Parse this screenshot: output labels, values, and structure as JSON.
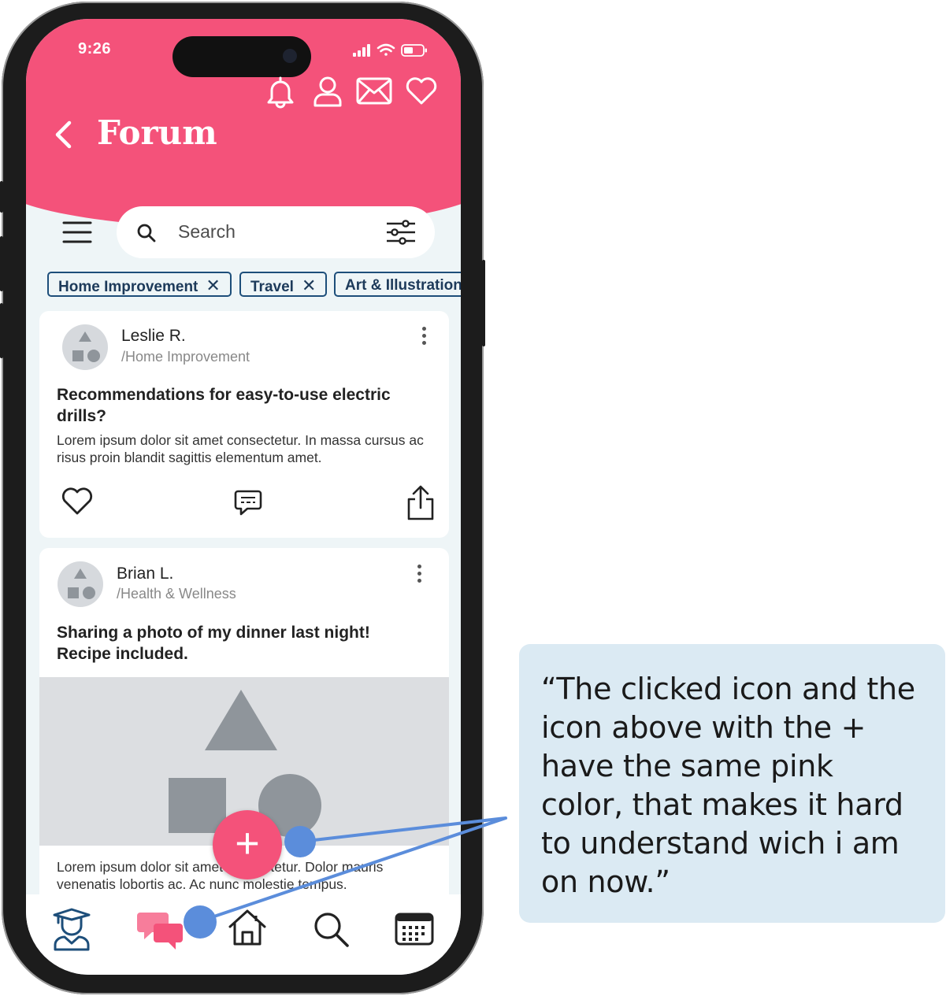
{
  "status_bar": {
    "time": "9:26"
  },
  "header": {
    "title": "Forum"
  },
  "search": {
    "placeholder": "Search"
  },
  "chips": [
    {
      "label": "Home Improvement"
    },
    {
      "label": "Travel"
    },
    {
      "label": "Art & Illustration"
    }
  ],
  "posts": [
    {
      "author": "Leslie R.",
      "category": "/Home Improvement",
      "title": "Recommendations for easy-to-use electric drills?",
      "body": "Lorem ipsum dolor sit amet consectetur. In massa cursus ac risus proin blandit sagittis elementum amet."
    },
    {
      "author": "Brian L.",
      "category": "/Health & Wellness",
      "title": "Sharing a photo of my dinner last night! Recipe included.",
      "body": "Lorem ipsum dolor sit amet consectetur. Dolor mauris venenatis lobortis ac. Ac nunc molestie tempus."
    }
  ],
  "fab": {
    "label": "+"
  },
  "tab_bar": {
    "items": [
      {
        "icon": "graduate-icon"
      },
      {
        "icon": "chat-bubbles-icon",
        "active": true
      },
      {
        "icon": "home-icon"
      },
      {
        "icon": "search-icon"
      },
      {
        "icon": "calendar-icon"
      }
    ]
  },
  "colors": {
    "brand_pink": "#f4527a",
    "chip_border": "#1d4e7a",
    "annotation_blue": "#5b8ddb",
    "callout_bg": "#dbeaf3"
  },
  "annotation": {
    "text": "“The clicked icon and the icon above with the + have the same pink color, that makes it hard to understand wich i am on now.”"
  }
}
